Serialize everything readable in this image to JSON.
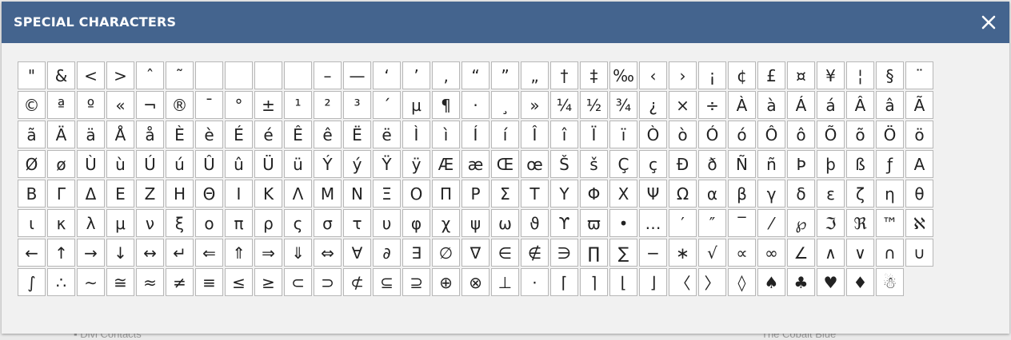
{
  "dialog": {
    "title": "SPECIAL CHARACTERS",
    "close_label": "×",
    "header_color": "#44648e"
  },
  "backdrop": {
    "left_text": "▪ Divi Contacts",
    "right_text": "The Cobalt Blue"
  },
  "characters": [
    "\"",
    "&",
    "<",
    ">",
    "ˆ",
    "˜",
    " ",
    " ",
    " ",
    " ",
    "–",
    "—",
    "‘",
    "’",
    "‚",
    "“",
    "”",
    "„",
    "†",
    "‡",
    "‰",
    "‹",
    "›",
    "¡",
    "¢",
    "£",
    "¤",
    "¥",
    "¦",
    "§",
    "¨",
    "©",
    "ª",
    "º",
    "«",
    "¬",
    "®",
    "¯",
    "°",
    "±",
    "¹",
    "²",
    "³",
    "´",
    "µ",
    "¶",
    "·",
    "¸",
    "»",
    "¼",
    "½",
    "¾",
    "¿",
    "×",
    "÷",
    "À",
    "à",
    "Á",
    "á",
    "Â",
    "â",
    "Ã",
    "ã",
    "Ä",
    "ä",
    "Å",
    "å",
    "È",
    "è",
    "É",
    "é",
    "Ê",
    "ê",
    "Ë",
    "ë",
    "Ì",
    "ì",
    "Í",
    "í",
    "Î",
    "î",
    "Ï",
    "ï",
    "Ò",
    "ò",
    "Ó",
    "ó",
    "Ô",
    "ô",
    "Õ",
    "õ",
    "Ö",
    "ö",
    "Ø",
    "ø",
    "Ù",
    "ù",
    "Ú",
    "ú",
    "Û",
    "û",
    "Ü",
    "ü",
    "Ý",
    "ý",
    "Ÿ",
    "ÿ",
    "Æ",
    "æ",
    "Œ",
    "œ",
    "Š",
    "š",
    "Ç",
    "ç",
    "Ð",
    "ð",
    "Ñ",
    "ñ",
    "Þ",
    "þ",
    "ß",
    "ƒ",
    "Α",
    "Β",
    "Γ",
    "Δ",
    "Ε",
    "Ζ",
    "Η",
    "Θ",
    "Ι",
    "Κ",
    "Λ",
    "Μ",
    "Ν",
    "Ξ",
    "Ο",
    "Π",
    "Ρ",
    "Σ",
    "Τ",
    "Υ",
    "Φ",
    "Χ",
    "Ψ",
    "Ω",
    "α",
    "β",
    "γ",
    "δ",
    "ε",
    "ζ",
    "η",
    "θ",
    "ι",
    "κ",
    "λ",
    "μ",
    "ν",
    "ξ",
    "ο",
    "π",
    "ρ",
    "ς",
    "σ",
    "τ",
    "υ",
    "φ",
    "χ",
    "ψ",
    "ω",
    "ϑ",
    "ϒ",
    "ϖ",
    "•",
    "…",
    "′",
    "″",
    "‾",
    "⁄",
    "℘",
    "ℑ",
    "ℜ",
    "™",
    "ℵ",
    "←",
    "↑",
    "→",
    "↓",
    "↔",
    "↵",
    "⇐",
    "⇑",
    "⇒",
    "⇓",
    "⇔",
    "∀",
    "∂",
    "∃",
    "∅",
    "∇",
    "∈",
    "∉",
    "∋",
    "∏",
    "∑",
    "−",
    "∗",
    "√",
    "∝",
    "∞",
    "∠",
    "∧",
    "∨",
    "∩",
    "∪",
    "∫",
    "∴",
    "∼",
    "≅",
    "≈",
    "≠",
    "≡",
    "≤",
    "≥",
    "⊂",
    "⊃",
    "⊄",
    "⊆",
    "⊇",
    "⊕",
    "⊗",
    "⊥",
    "⋅",
    "⌈",
    "⌉",
    "⌊",
    "⌋",
    "〈",
    "〉",
    "◊",
    "♠",
    "♣",
    "♥",
    "♦",
    "☃"
  ]
}
